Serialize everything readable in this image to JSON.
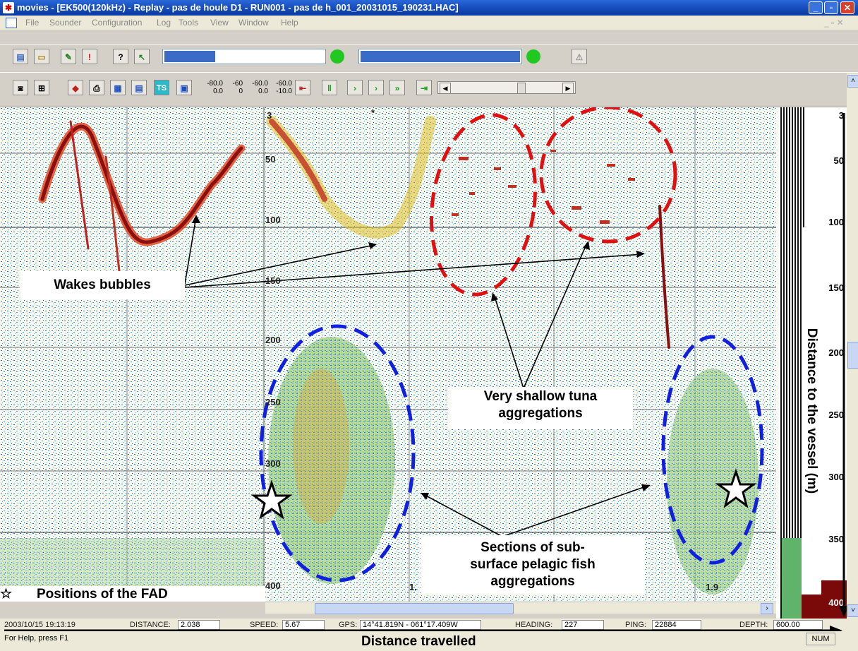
{
  "window": {
    "title": "movies - [EK500(120kHz) - Replay - pas de houle D1 - RUN001 - pas de h_001_20031015_190231.HAC]",
    "buttons": [
      "_",
      "▫",
      "✕"
    ]
  },
  "menu": [
    "File",
    "Sounder",
    "Configuration",
    "Log",
    "Tools",
    "View",
    "Window",
    "Help"
  ],
  "toolbar2_values": [
    [
      "-80.0",
      "0.0"
    ],
    [
      "-60",
      "0"
    ],
    [
      "-60.0",
      "0.0"
    ],
    [
      "-60.0",
      "-10.0"
    ]
  ],
  "echogram": {
    "grid_depths": [
      "3",
      "50",
      "100",
      "150",
      "200",
      "250",
      "300",
      "350",
      "400"
    ],
    "right_scale": [
      "3",
      "50",
      "100",
      "150",
      "200",
      "250",
      "300",
      "350",
      "400"
    ],
    "bottom_markers": [
      "1.",
      "1.9"
    ],
    "top_marker": "*"
  },
  "annotations": {
    "wakes": "Wakes bubbles",
    "tuna_line1": "Very shallow tuna",
    "tuna_line2": "aggregations",
    "pelagic_line1": "Sections of sub-",
    "pelagic_line2": "surface pelagic fish",
    "pelagic_line3": "aggregations",
    "fad": "Positions of the FAD",
    "x_axis": "Distance travelled",
    "y_axis": "Distance to the vessel (m)"
  },
  "status_fields": {
    "datetime": "2003/10/15 19:13:19",
    "distance_label": "DISTANCE:",
    "distance": "2.038",
    "speed_label": "SPEED:",
    "speed": "5.67",
    "gps_label": "GPS:",
    "gps": "14°41.819N - 061°17.409W",
    "heading_label": "HEADING:",
    "heading": "227",
    "ping_label": "PING:",
    "ping": "22884",
    "depth_label": "DEPTH:",
    "depth": "600.00"
  },
  "statusbar": {
    "help": "For Help, press F1",
    "num": "NUM"
  },
  "colors": {
    "title_blue": "#1448b8",
    "progress_blue": "#3a6bc6",
    "ok_green": "#22c822",
    "ellipse_red": "#e01010",
    "ellipse_blue": "#1020e0"
  }
}
